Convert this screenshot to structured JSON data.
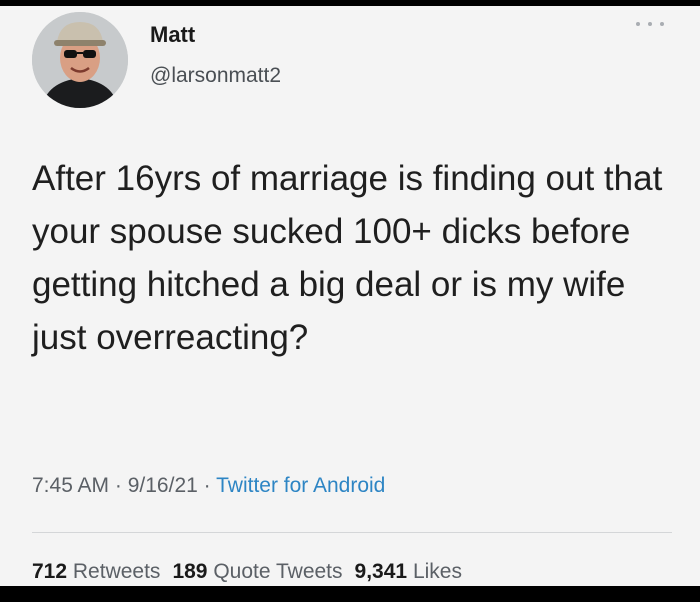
{
  "author": {
    "name": "Matt",
    "handle": "@larsonmatt2",
    "avatar_icon": "user-avatar-photo"
  },
  "menu_icon": "more-options-icon",
  "tweet": {
    "text": "After 16yrs of marriage is finding out that your spouse sucked 100+ dicks before getting hitched a big deal or is my wife just overreacting?"
  },
  "meta": {
    "time": "7:45 AM",
    "separator": " · ",
    "date": "9/16/21",
    "source": "Twitter for Android"
  },
  "stats": {
    "retweets_count": "712",
    "retweets_label": "Retweets",
    "quotes_count": "189",
    "quotes_label": "Quote Tweets",
    "likes_count": "9,341",
    "likes_label": "Likes"
  },
  "colors": {
    "background": "#f4f4f4",
    "text": "#1f1f1f",
    "muted": "#5b6066",
    "link": "#2d85c4"
  }
}
